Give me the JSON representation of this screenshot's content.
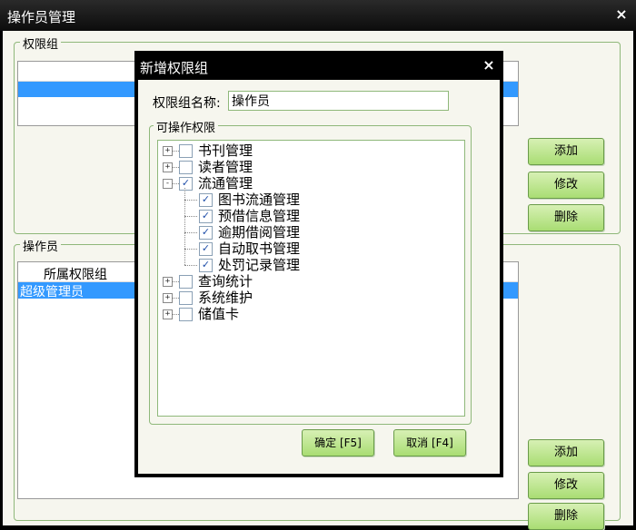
{
  "window": {
    "title": "操作员管理",
    "close_glyph": "×"
  },
  "permission_group": {
    "legend": "权限组",
    "buttons": {
      "add": "添加",
      "edit": "修改",
      "delete": "删除"
    }
  },
  "operators": {
    "legend": "操作员",
    "column_header": "所属权限组",
    "rows": [
      "超级管理员"
    ],
    "buttons": {
      "add": "添加",
      "edit": "修改",
      "delete": "删除"
    }
  },
  "dialog": {
    "title": "新增权限组",
    "close_glyph": "×",
    "name_label": "权限组名称:",
    "name_value": "操作员",
    "perm_legend": "可操作权限",
    "tree": [
      {
        "label": "书刊管理",
        "expander": "+",
        "checked": false
      },
      {
        "label": "读者管理",
        "expander": "+",
        "checked": false
      },
      {
        "label": "流通管理",
        "expander": "-",
        "checked": true,
        "children": [
          {
            "label": "图书流通管理",
            "checked": true
          },
          {
            "label": "预借信息管理",
            "checked": true
          },
          {
            "label": "逾期借阅管理",
            "checked": true
          },
          {
            "label": "自动取书管理",
            "checked": true
          },
          {
            "label": "处罚记录管理",
            "checked": true
          }
        ]
      },
      {
        "label": "查询统计",
        "expander": "+",
        "checked": false
      },
      {
        "label": "系统维护",
        "expander": "+",
        "checked": false
      },
      {
        "label": "储值卡",
        "expander": "+",
        "checked": false
      }
    ],
    "ok_button": "确定 [F5]",
    "cancel_button": "取消 [F4]"
  }
}
